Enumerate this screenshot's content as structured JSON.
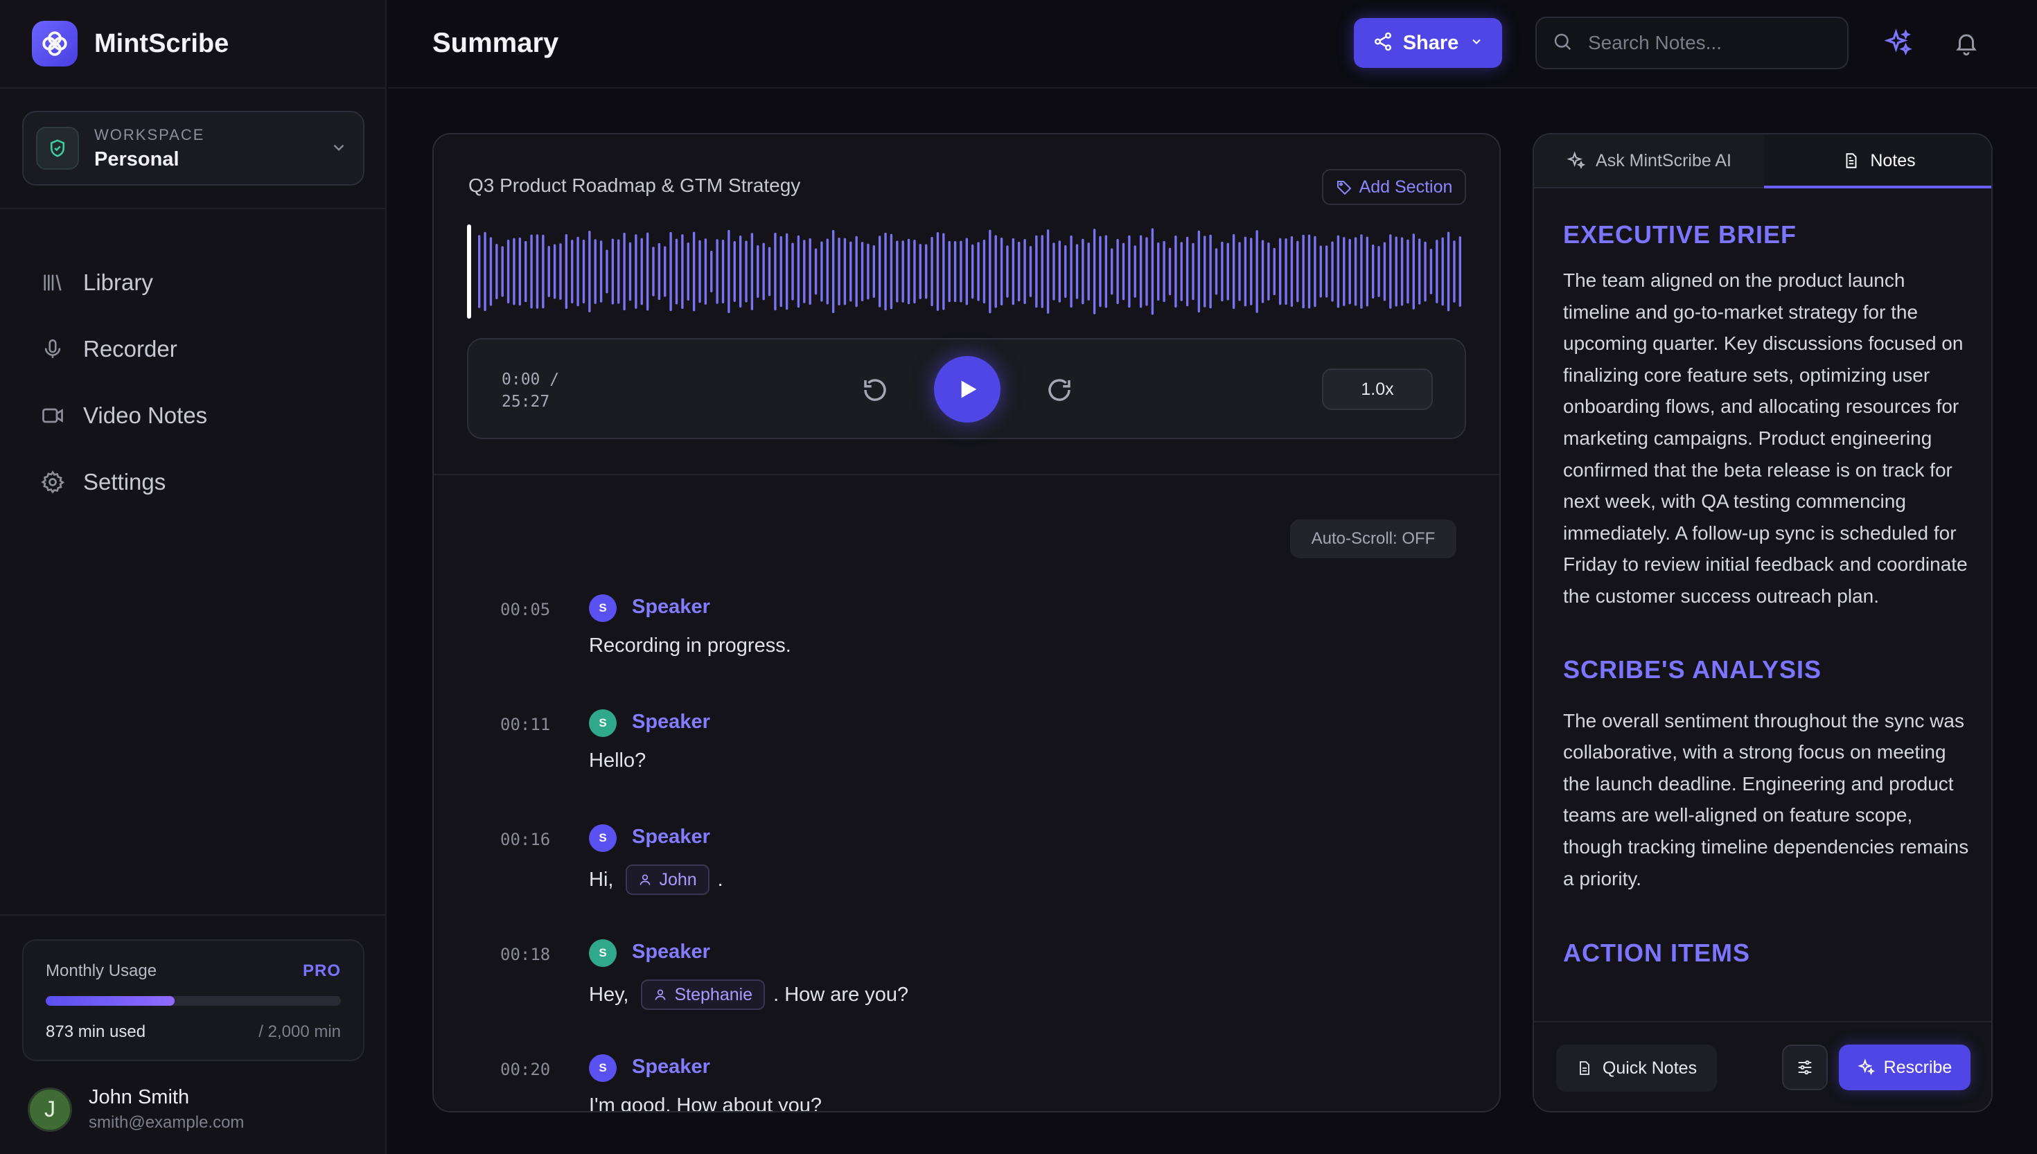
{
  "sidebar": {
    "brand": "MintScribe",
    "workspace": {
      "label": "WORKSPACE",
      "value": "Personal"
    },
    "nav": [
      {
        "label": "Library",
        "icon": "library-icon"
      },
      {
        "label": "Recorder",
        "icon": "microphone-icon"
      },
      {
        "label": "Video Notes",
        "icon": "video-icon"
      },
      {
        "label": "Settings",
        "icon": "gear-icon"
      }
    ],
    "usage": {
      "title": "Monthly Usage",
      "plan": "PRO",
      "used_label": "873 min used",
      "max_label": "/ 2,000 min",
      "used": 873,
      "max": 2000
    },
    "user": {
      "initial": "J",
      "name": "John Smith",
      "email": "smith@example.com"
    }
  },
  "header": {
    "title": "Summary",
    "share_label": "Share",
    "search_placeholder": "Search Notes..."
  },
  "recording": {
    "title": "Q3 Product Roadmap & GTM Strategy",
    "add_section_label": "Add Section",
    "current_time": "0:00 /",
    "duration": "25:27",
    "speed": "1.0x",
    "progress": 0.0,
    "autoscroll_label": "Auto-Scroll: OFF"
  },
  "transcript": [
    {
      "time": "00:05",
      "speaker": "Speaker",
      "initial": "S",
      "color": "#5b50f0",
      "parts": [
        "Recording in progress."
      ]
    },
    {
      "time": "00:11",
      "speaker": "Speaker",
      "initial": "S",
      "color": "#2fa88c",
      "parts": [
        "Hello?"
      ]
    },
    {
      "time": "00:16",
      "speaker": "Speaker",
      "initial": "S",
      "color": "#5b50f0",
      "parts": [
        "Hi,",
        "@John",
        "."
      ]
    },
    {
      "time": "00:18",
      "speaker": "Speaker",
      "initial": "S",
      "color": "#2fa88c",
      "parts": [
        "Hey,",
        "@Stephanie",
        ". How are you?"
      ]
    },
    {
      "time": "00:20",
      "speaker": "Speaker",
      "initial": "S",
      "color": "#5b50f0",
      "parts": [
        "I'm good. How about you?"
      ]
    }
  ],
  "right_panel": {
    "tabs": [
      {
        "label": "Ask MintScribe AI",
        "icon": "sparkle-icon",
        "active": false
      },
      {
        "label": "Notes",
        "icon": "document-icon",
        "active": true
      }
    ],
    "sections": [
      {
        "heading": "EXECUTIVE BRIEF",
        "body": "The team aligned on the product launch timeline and go-to-market strategy for the upcoming quarter. Key discussions focused on finalizing core feature sets, optimizing user onboarding flows, and allocating resources for marketing campaigns. Product engineering confirmed that the beta release is on track for next week, with QA testing commencing immediately. A follow-up sync is scheduled for Friday to review initial feedback and coordinate the customer success outreach plan."
      },
      {
        "heading": "SCRIBE'S ANALYSIS",
        "body": "The overall sentiment throughout the sync was collaborative, with a strong focus on meeting the launch deadline. Engineering and product teams are well-aligned on feature scope, though tracking timeline dependencies remains a priority."
      },
      {
        "heading": "ACTION ITEMS",
        "body": ""
      }
    ],
    "quick_notes_label": "Quick Notes",
    "rescribe_label": "Rescribe"
  },
  "colors": {
    "accent": "#4f46e5",
    "accent_text": "#7d74ff",
    "background": "#0c0c12",
    "waveform": "#7b72f0"
  }
}
